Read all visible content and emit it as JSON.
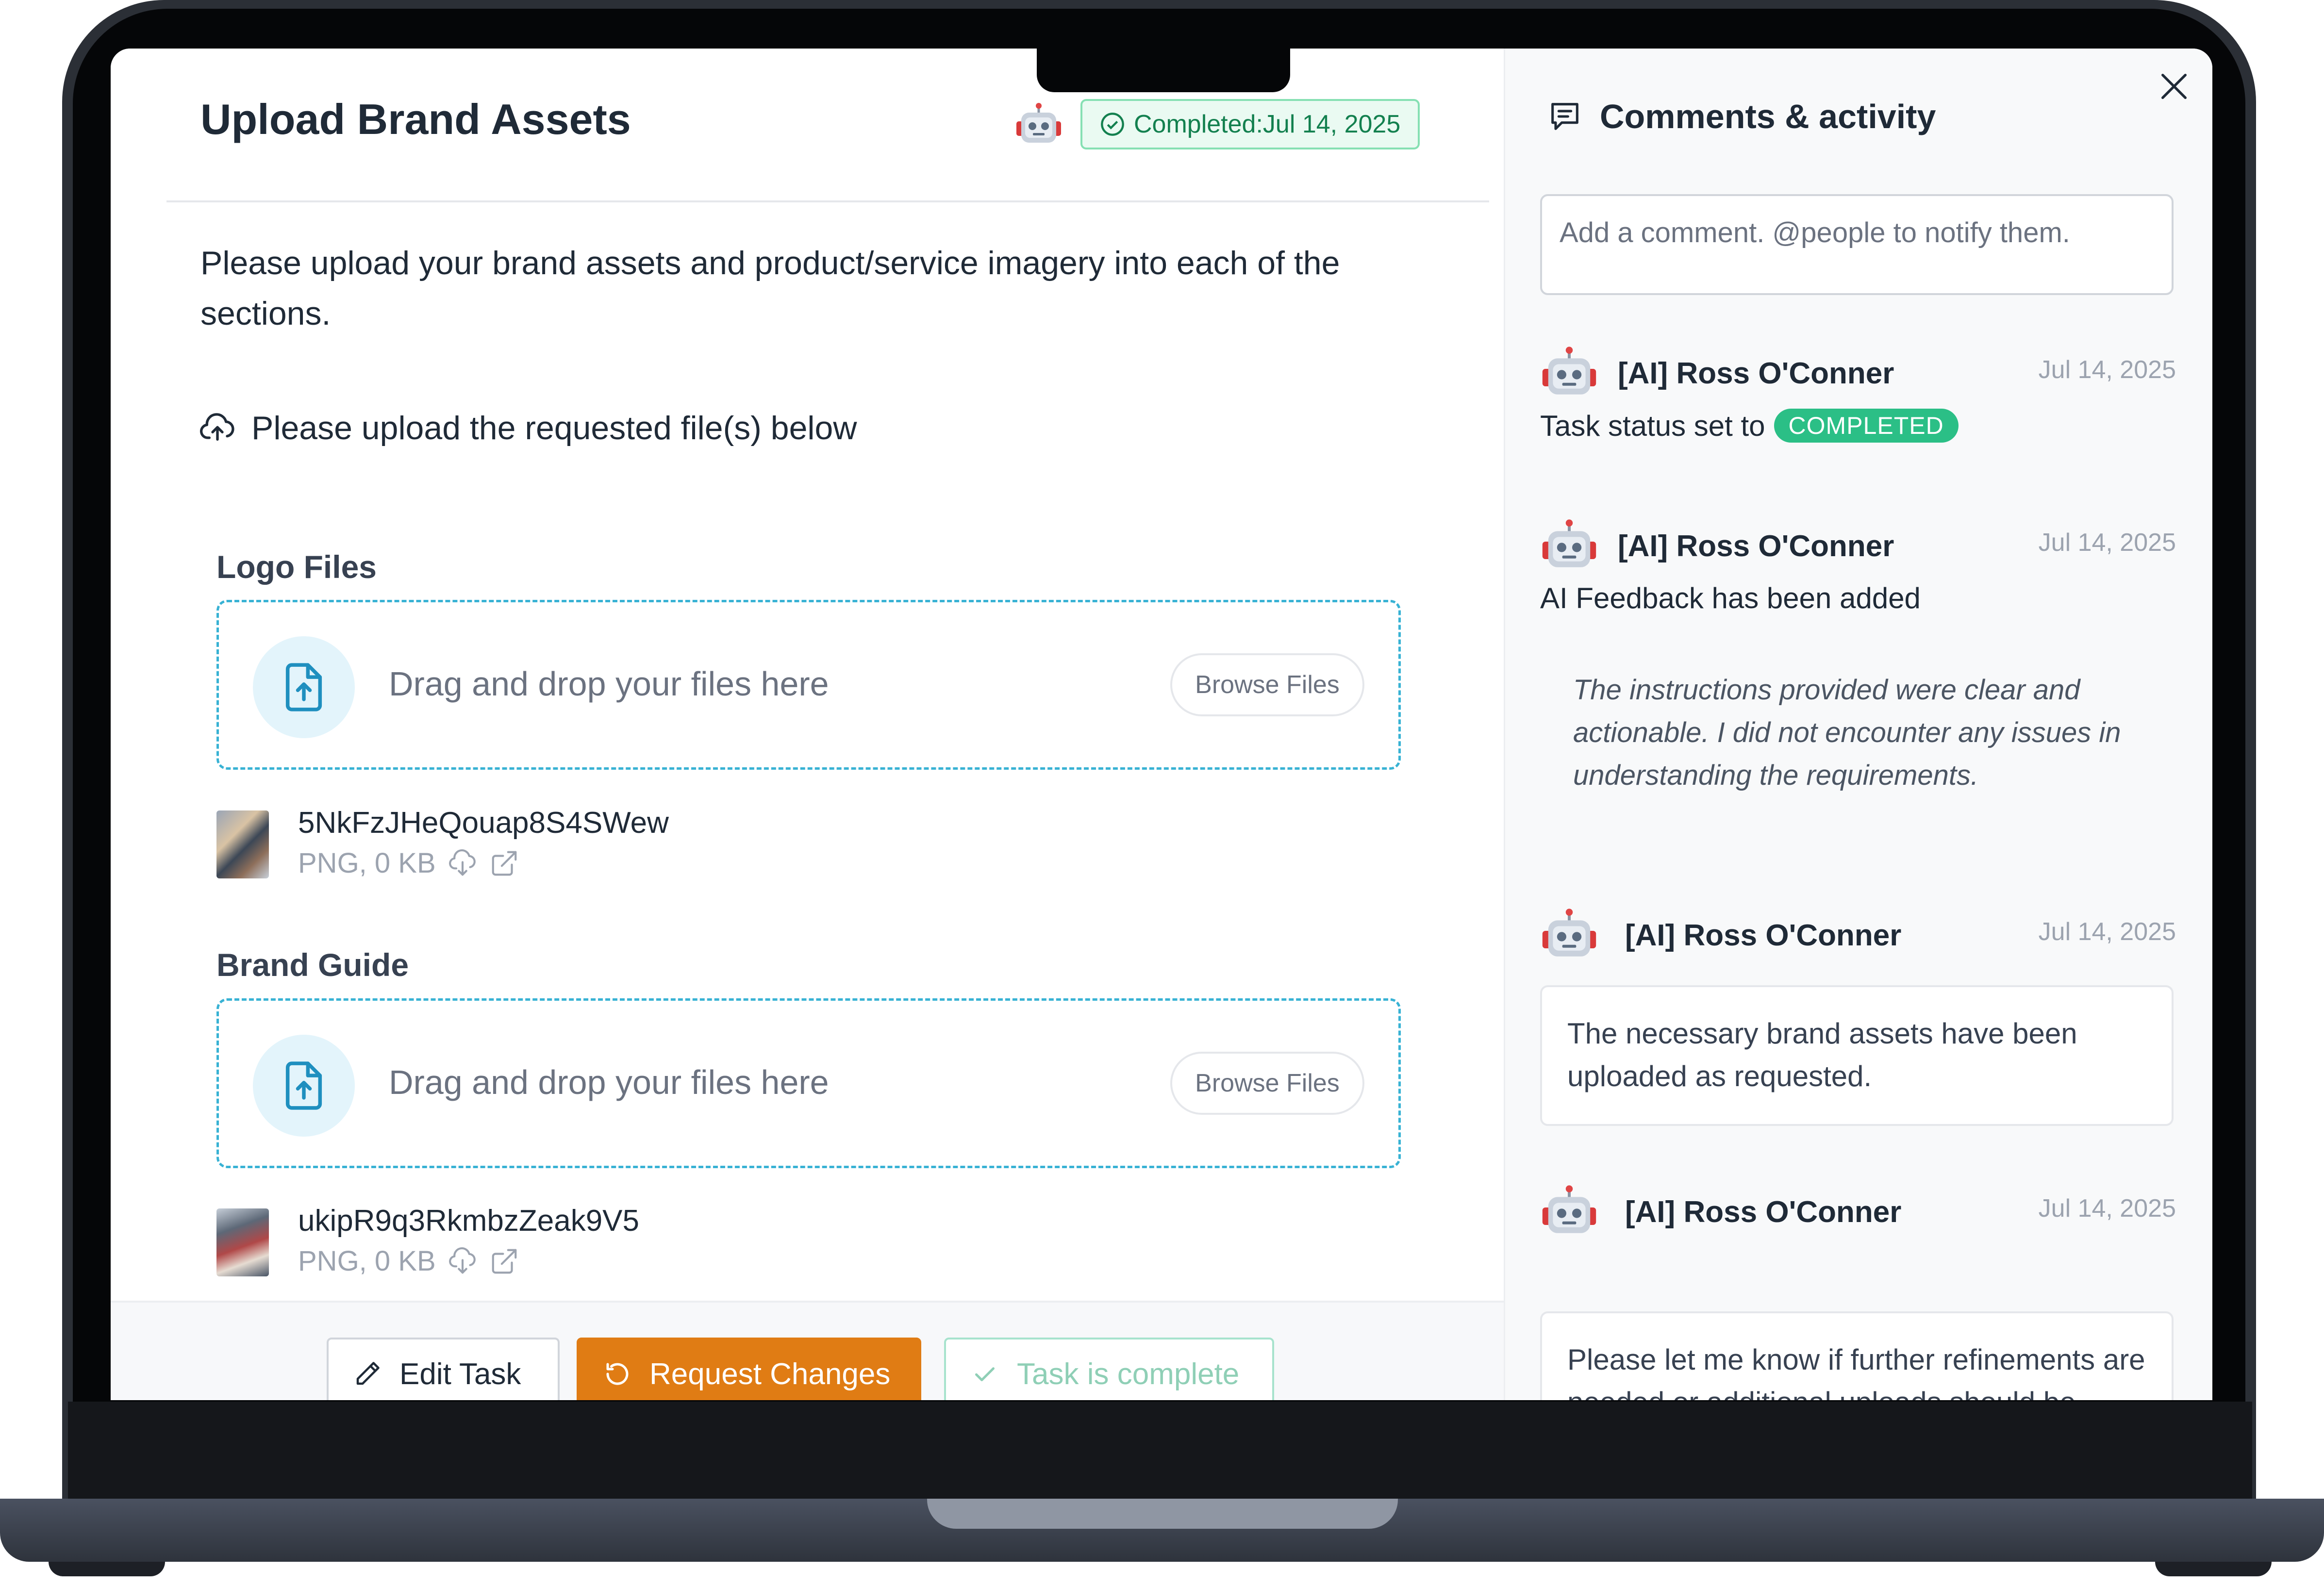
{
  "task": {
    "title": "Upload Brand Assets",
    "status_label": "Completed:Jul 14, 2025",
    "instructions": "Please upload your brand assets and product/service imagery into each of the sections.",
    "upload_heading": "Please upload the requested file(s) below"
  },
  "sections": [
    {
      "title": "Logo Files",
      "dropzone_text": "Drag and drop your files here",
      "browse_label": "Browse Files",
      "file": {
        "name": "5NkFzJHeQouap8S4SWew",
        "meta": "PNG, 0 KB"
      }
    },
    {
      "title": "Brand Guide",
      "dropzone_text": "Drag and drop your files here",
      "browse_label": "Browse Files",
      "file": {
        "name": "ukipR9q3RkmbzZeak9V5",
        "meta": "PNG, 0 KB"
      }
    }
  ],
  "footer": {
    "edit_label": "Edit Task",
    "request_label": "Request Changes",
    "complete_label": "Task is complete"
  },
  "comments": {
    "title": "Comments & activity",
    "input_placeholder": "Add a comment. @people to notify them.",
    "activities": [
      {
        "author": "[AI] Ross O'Conner",
        "date": "Jul 14, 2025",
        "text": "Task status set to",
        "badge": "COMPLETED"
      },
      {
        "author": "[AI] Ross O'Conner",
        "date": "Jul 14, 2025",
        "text": "AI Feedback has been added",
        "quote": "The instructions provided were clear and actionable. I did not encounter any issues in understanding the requirements."
      },
      {
        "author": "[AI] Ross O'Conner",
        "date": "Jul 14, 2025",
        "card": "The necessary brand assets have been uploaded as requested."
      },
      {
        "author": "[AI] Ross O'Conner",
        "date": "Jul 14, 2025",
        "card": "Please let me know if further refinements are needed or additional uploads should be made."
      }
    ]
  },
  "colors": {
    "accent_blue": "#38b2d4",
    "status_green": "#2bbf86",
    "request_orange": "#e07c14"
  },
  "icons": {
    "status": "check-circle-icon",
    "upload": "cloud-upload-icon",
    "file": "file-upload-icon",
    "download": "cloud-download-icon",
    "open": "external-link-icon",
    "edit": "pencil-icon",
    "request": "refresh-icon",
    "complete": "check-icon",
    "comments": "chat-icon",
    "close": "close-icon",
    "avatar": "robot-icon"
  }
}
